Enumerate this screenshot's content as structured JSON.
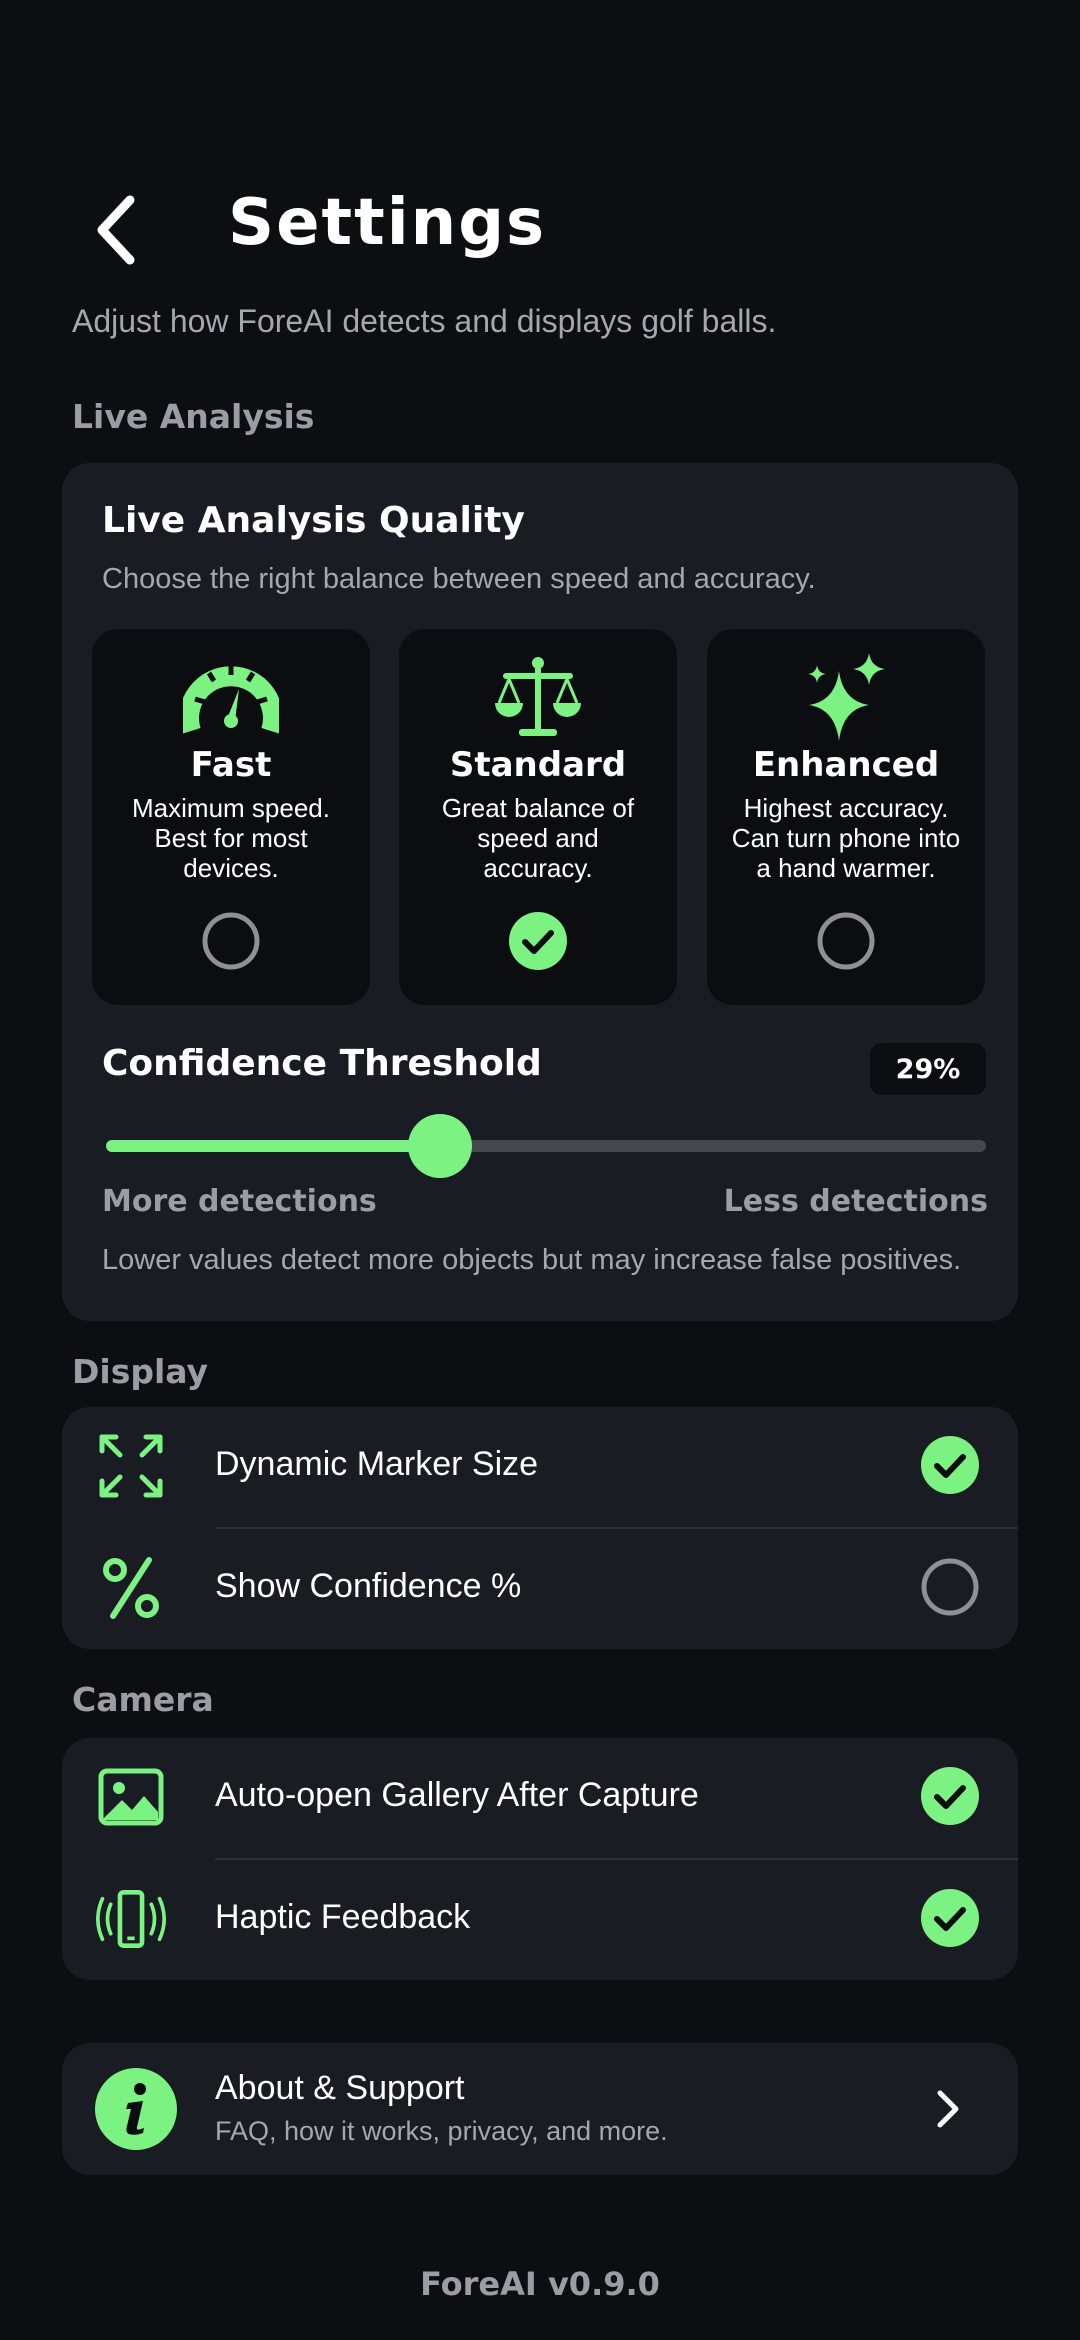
{
  "header": {
    "title": "Settings",
    "subtitle": "Adjust how ForeAI detects and displays golf balls."
  },
  "live_analysis": {
    "section_label": "Live Analysis",
    "quality_title": "Live Analysis Quality",
    "quality_desc": "Choose the right balance between speed and accuracy.",
    "modes": [
      {
        "name": "Fast",
        "desc": "Maximum speed. Best for most devices.",
        "icon": "speedometer-icon",
        "selected": false
      },
      {
        "name": "Standard",
        "desc": "Great balance of speed and accuracy.",
        "icon": "scale-icon",
        "selected": true
      },
      {
        "name": "Enhanced",
        "desc": "Highest accuracy. Can turn phone into a hand warmer.",
        "icon": "sparkles-icon",
        "selected": false
      }
    ],
    "confidence": {
      "title": "Confidence Threshold",
      "value_label": "29%",
      "value_fraction": 0.38,
      "min_label": "More detections",
      "max_label": "Less detections",
      "hint": "Lower values detect more objects but may increase false positives."
    }
  },
  "display": {
    "section_label": "Display",
    "items": [
      {
        "label": "Dynamic Marker Size",
        "icon": "expand-arrows-icon",
        "checked": true
      },
      {
        "label": "Show Confidence %",
        "icon": "percent-icon",
        "checked": false
      }
    ]
  },
  "camera": {
    "section_label": "Camera",
    "items": [
      {
        "label": "Auto-open Gallery After Capture",
        "icon": "image-icon",
        "checked": true
      },
      {
        "label": "Haptic Feedback",
        "icon": "phone-vibrate-icon",
        "checked": true
      }
    ]
  },
  "about": {
    "title": "About & Support",
    "subtitle": "FAQ, how it works, privacy, and more."
  },
  "footer": {
    "version": "ForeAI v0.9.0"
  },
  "colors": {
    "accent": "#7cf283",
    "background": "#0c0e11",
    "card": "#191c22",
    "muted_text": "#9a9ea4"
  }
}
